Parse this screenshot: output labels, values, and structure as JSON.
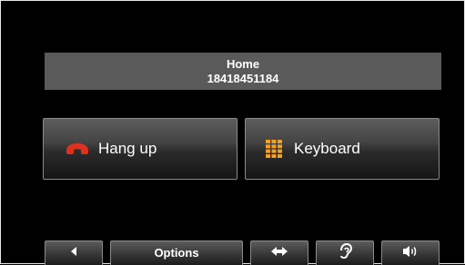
{
  "caller": {
    "name": "Home",
    "number": "18418451184"
  },
  "buttons": {
    "hang_up": {
      "label": "Hang up",
      "icon": "phone-hangup-icon",
      "icon_color": "#e0301e"
    },
    "keyboard": {
      "label": "Keyboard",
      "icon": "keypad-grid-icon",
      "icon_color": "#f5a21a"
    }
  },
  "bottom_bar": {
    "back": {
      "icon": "triangle-left-icon"
    },
    "options": {
      "label": "Options"
    },
    "arrows": {
      "icon": "left-right-arrows-icon"
    },
    "hearing": {
      "icon": "ear-icon"
    },
    "volume": {
      "icon": "speaker-volume-icon"
    }
  }
}
